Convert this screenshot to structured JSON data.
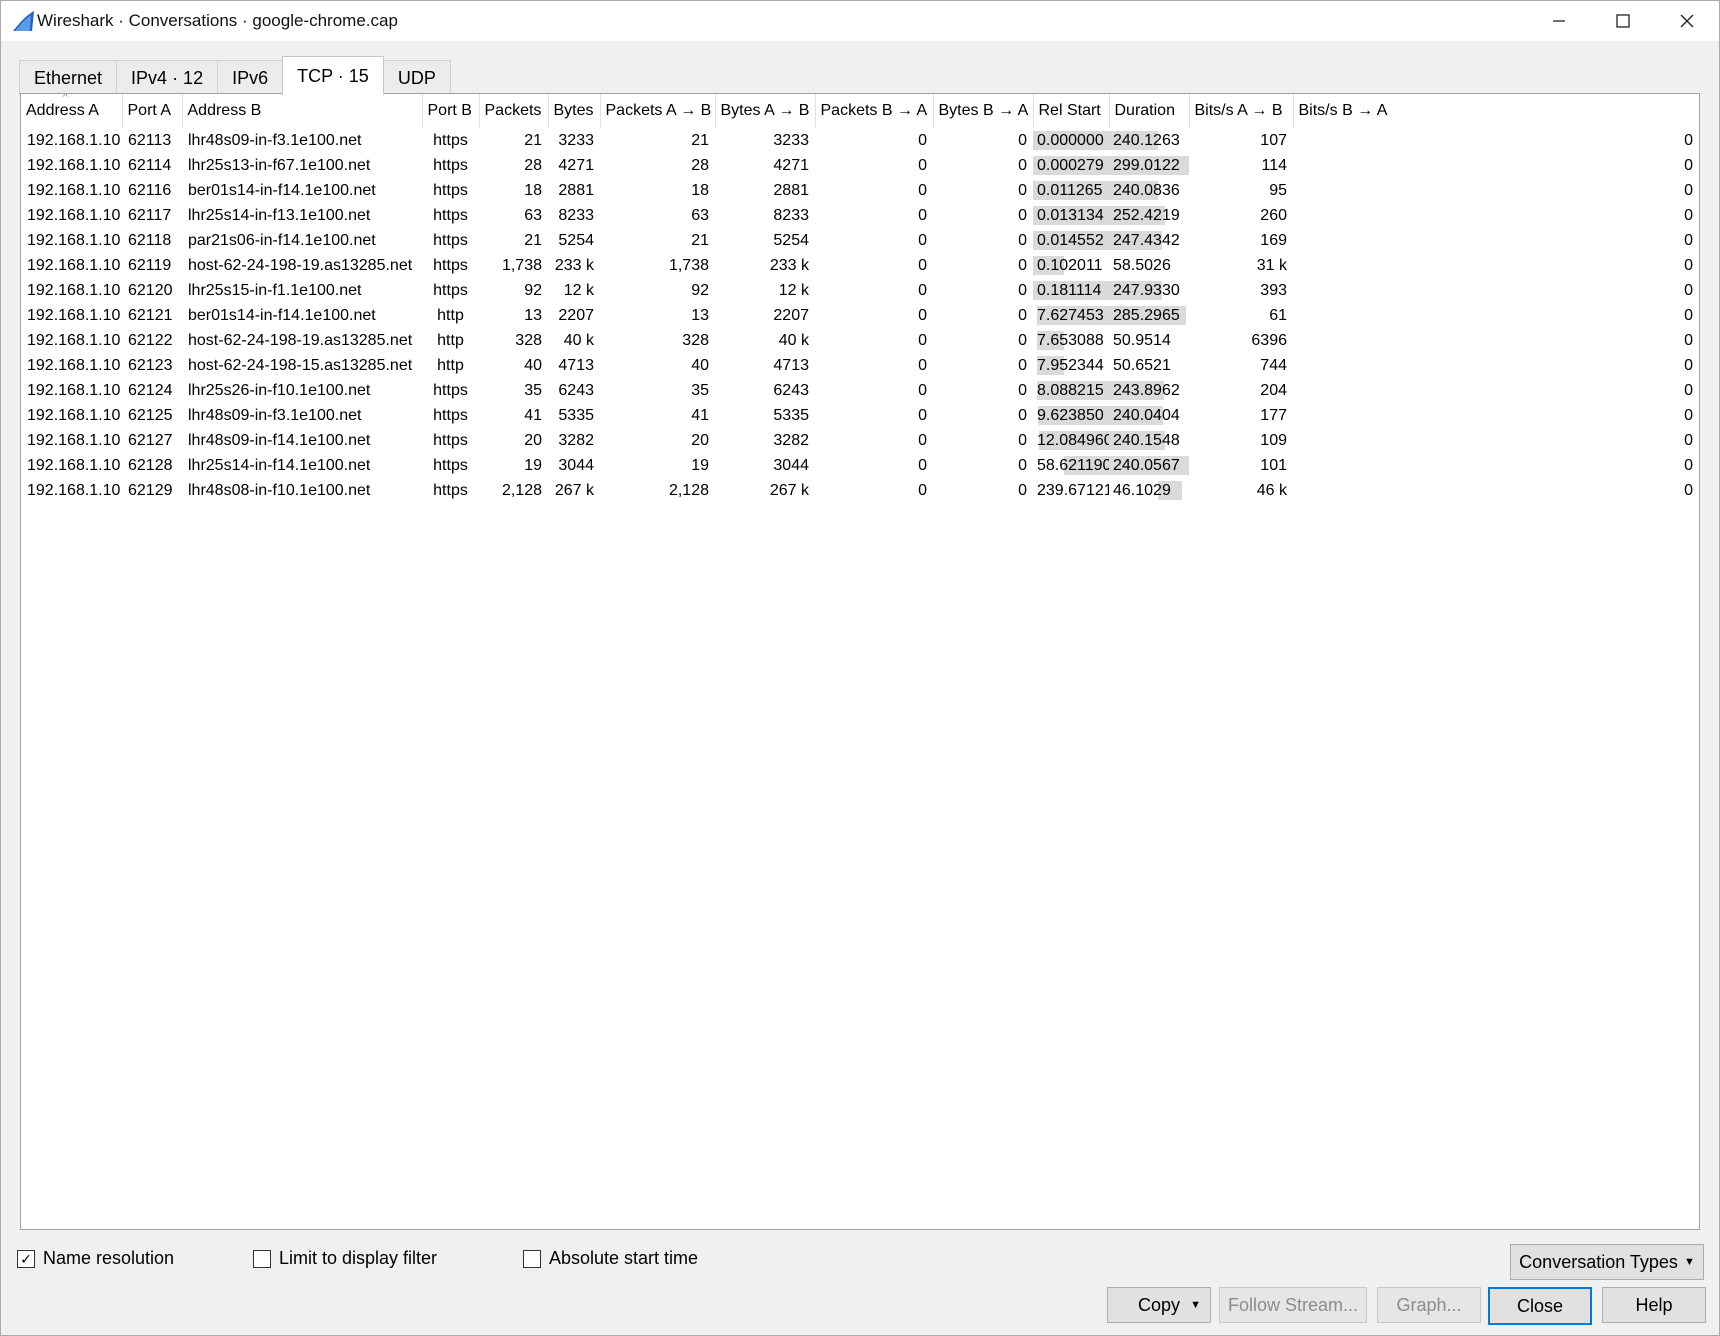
{
  "window": {
    "title": "Wireshark · Conversations · google-chrome.cap"
  },
  "tabs": [
    {
      "label": "Ethernet",
      "active": false
    },
    {
      "label": "IPv4 · 12",
      "active": false
    },
    {
      "label": "IPv6",
      "active": false
    },
    {
      "label": "TCP · 15",
      "active": true
    },
    {
      "label": "UDP",
      "active": false
    }
  ],
  "table": {
    "columns": [
      "Address A",
      "Port A",
      "Address B",
      "Port B",
      "Packets",
      "Bytes",
      "Packets A → B",
      "Bytes A → B",
      "Packets B → A",
      "Bytes B → A",
      "Rel Start",
      "Duration",
      "Bits/s A → B",
      "Bits/s B → A"
    ],
    "rows": [
      [
        "192.168.1.10",
        "62113",
        "lhr48s09-in-f3.1e100.net",
        "https",
        "21",
        "3233",
        "21",
        "3233",
        "0",
        "0",
        "0.000000",
        "240.1263",
        "107",
        "0"
      ],
      [
        "192.168.1.10",
        "62114",
        "lhr25s13-in-f67.1e100.net",
        "https",
        "28",
        "4271",
        "28",
        "4271",
        "0",
        "0",
        "0.000279",
        "299.0122",
        "114",
        "0"
      ],
      [
        "192.168.1.10",
        "62116",
        "ber01s14-in-f14.1e100.net",
        "https",
        "18",
        "2881",
        "18",
        "2881",
        "0",
        "0",
        "0.011265",
        "240.0836",
        "95",
        "0"
      ],
      [
        "192.168.1.10",
        "62117",
        "lhr25s14-in-f13.1e100.net",
        "https",
        "63",
        "8233",
        "63",
        "8233",
        "0",
        "0",
        "0.013134",
        "252.4219",
        "260",
        "0"
      ],
      [
        "192.168.1.10",
        "62118",
        "par21s06-in-f14.1e100.net",
        "https",
        "21",
        "5254",
        "21",
        "5254",
        "0",
        "0",
        "0.014552",
        "247.4342",
        "169",
        "0"
      ],
      [
        "192.168.1.10",
        "62119",
        "host-62-24-198-19.as13285.net",
        "https",
        "1,738",
        "233 k",
        "1,738",
        "233 k",
        "0",
        "0",
        "0.102011",
        "58.5026",
        "31 k",
        "0"
      ],
      [
        "192.168.1.10",
        "62120",
        "lhr25s15-in-f1.1e100.net",
        "https",
        "92",
        "12 k",
        "92",
        "12 k",
        "0",
        "0",
        "0.181114",
        "247.9330",
        "393",
        "0"
      ],
      [
        "192.168.1.10",
        "62121",
        "ber01s14-in-f14.1e100.net",
        "http",
        "13",
        "2207",
        "13",
        "2207",
        "0",
        "0",
        "7.627453",
        "285.2965",
        "61",
        "0"
      ],
      [
        "192.168.1.10",
        "62122",
        "host-62-24-198-19.as13285.net",
        "http",
        "328",
        "40 k",
        "328",
        "40 k",
        "0",
        "0",
        "7.653088",
        "50.9514",
        "6396",
        "0"
      ],
      [
        "192.168.1.10",
        "62123",
        "host-62-24-198-15.as13285.net",
        "http",
        "40",
        "4713",
        "40",
        "4713",
        "0",
        "0",
        "7.952344",
        "50.6521",
        "744",
        "0"
      ],
      [
        "192.168.1.10",
        "62124",
        "lhr25s26-in-f10.1e100.net",
        "https",
        "35",
        "6243",
        "35",
        "6243",
        "0",
        "0",
        "8.088215",
        "243.8962",
        "204",
        "0"
      ],
      [
        "192.168.1.10",
        "62125",
        "lhr48s09-in-f3.1e100.net",
        "https",
        "41",
        "5335",
        "41",
        "5335",
        "0",
        "0",
        "9.623850",
        "240.0404",
        "177",
        "0"
      ],
      [
        "192.168.1.10",
        "62127",
        "lhr48s09-in-f14.1e100.net",
        "https",
        "20",
        "3282",
        "20",
        "3282",
        "0",
        "0",
        "12.084960",
        "240.1548",
        "109",
        "0"
      ],
      [
        "192.168.1.10",
        "62128",
        "lhr25s14-in-f14.1e100.net",
        "https",
        "19",
        "3044",
        "19",
        "3044",
        "0",
        "0",
        "58.621190",
        "240.0567",
        "101",
        "0"
      ],
      [
        "192.168.1.10",
        "62129",
        "lhr48s08-in-f10.1e100.net",
        "https",
        "2,128",
        "267 k",
        "2,128",
        "267 k",
        "0",
        "0",
        "239.671212",
        "46.1029",
        "46 k",
        "0"
      ]
    ]
  },
  "options": {
    "name_resolution": {
      "label": "Name resolution",
      "checked": true
    },
    "limit_filter": {
      "label": "Limit to display filter",
      "checked": false
    },
    "absolute_start": {
      "label": "Absolute start time",
      "checked": false
    }
  },
  "buttons": {
    "conversation_types": "Conversation Types",
    "copy": "Copy",
    "follow_stream": "Follow Stream...",
    "graph": "Graph...",
    "close": "Close",
    "help": "Help"
  },
  "colors": {
    "accent": "#0078d7",
    "bar": "#dadada",
    "icon": "#1e63c4"
  }
}
